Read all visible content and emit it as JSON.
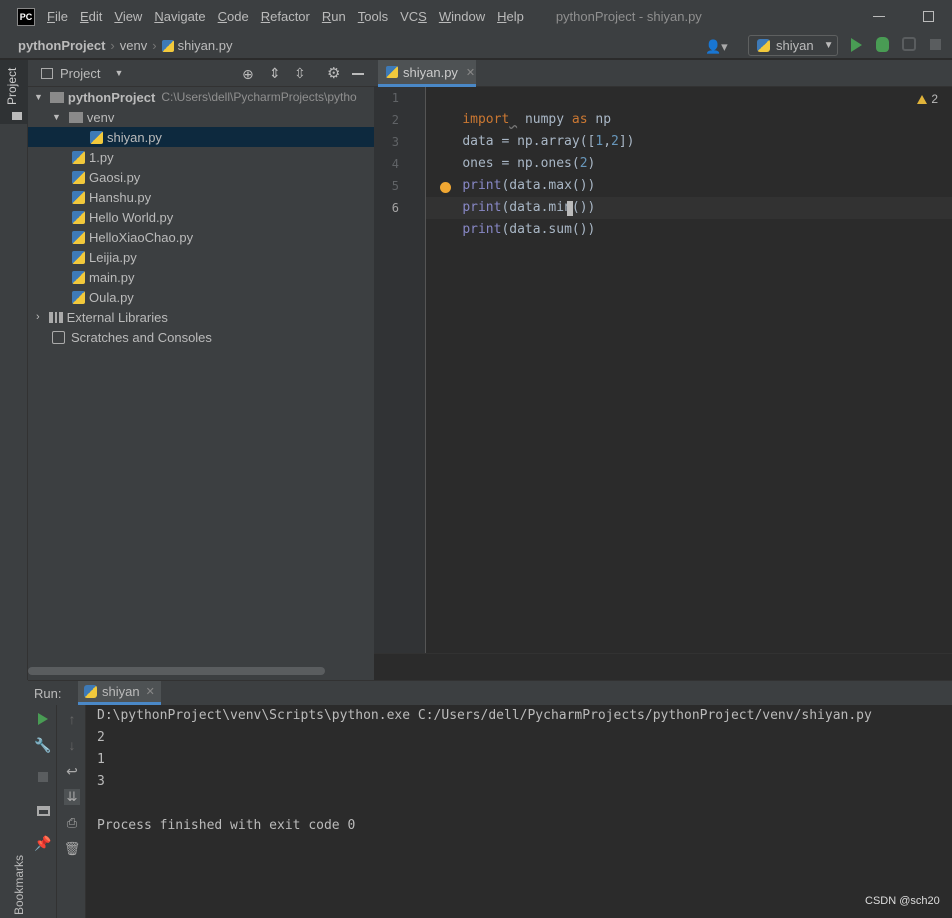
{
  "app": {
    "logo_text": "PC",
    "window_title": "pythonProject - shiyan.py"
  },
  "menu": {
    "items": [
      {
        "label": "File",
        "mnemonic": "F",
        "rest": "ile"
      },
      {
        "label": "Edit",
        "mnemonic": "E",
        "rest": "dit"
      },
      {
        "label": "View",
        "mnemonic": "V",
        "rest": "iew"
      },
      {
        "label": "Navigate",
        "mnemonic": "N",
        "rest": "avigate"
      },
      {
        "label": "Code",
        "mnemonic": "C",
        "rest": "ode"
      },
      {
        "label": "Refactor",
        "mnemonic": "R",
        "rest": "efactor"
      },
      {
        "label": "Run",
        "mnemonic": "R",
        "rest": "un"
      },
      {
        "label": "Tools",
        "mnemonic": "T",
        "rest": "ools"
      },
      {
        "label": "VCS",
        "mnemonic": "S",
        "rest": "VC"
      },
      {
        "label": "Window",
        "mnemonic": "W",
        "rest": "indow"
      },
      {
        "label": "Help",
        "mnemonic": "H",
        "rest": "elp"
      }
    ]
  },
  "breadcrumb": {
    "project": "pythonProject",
    "folder": "venv",
    "file": "shiyan.py"
  },
  "run_config": {
    "selected": "shiyan"
  },
  "left_strip": {
    "project_label": "Project",
    "bookmarks_label": "Bookmarks"
  },
  "project_panel": {
    "title": "Project",
    "tree": {
      "root_name": "pythonProject",
      "root_path": "C:\\Users\\dell\\PycharmProjects\\pytho",
      "venv": "venv",
      "venv_file": "shiyan.py",
      "files": [
        "1.py",
        "Gaosi.py",
        "Hanshu.py",
        "Hello World.py",
        "HelloXiaoChao.py",
        "Leijia.py",
        "main.py",
        "Oula.py"
      ],
      "external": "External Libraries",
      "scratches": "Scratches and Consoles"
    }
  },
  "editor": {
    "tab_label": "shiyan.py",
    "warning_count": "2",
    "line_numbers": [
      "1",
      "2",
      "3",
      "4",
      "5",
      "6"
    ],
    "code": {
      "l1_kw": "import",
      "l1_mod": "numpy",
      "l1_as": "as",
      "l1_alias": "np",
      "l2_a": "data = np.array([",
      "l2_n1": "1",
      "l2_comma": ",",
      "l2_n2": "2",
      "l2_b": "])",
      "l3_a": "ones = np.ones(",
      "l3_n": "2",
      "l3_b": ")",
      "l4_fn": "print",
      "l4_rest": "(data.max())",
      "l5_fn": "print",
      "l5_rest": "(data.min())",
      "l6_fn": "print",
      "l6_rest": "(data.sum())"
    }
  },
  "run_panel": {
    "label": "Run:",
    "tab_label": "shiyan",
    "output": [
      "D:\\pythonProject\\venv\\Scripts\\python.exe C:/Users/dell/PycharmProjects/pythonProject/venv/shiyan.py",
      "2",
      "1",
      "3",
      "",
      "Process finished with exit code 0"
    ]
  },
  "watermark": "CSDN @sch20",
  "colors": {
    "background": "#2b2b2b",
    "panel": "#3c3f41",
    "keyword": "#cc7832",
    "number": "#6897bb",
    "builtin": "#8888c6",
    "run_green": "#499c54",
    "accent": "#4a88c7"
  }
}
